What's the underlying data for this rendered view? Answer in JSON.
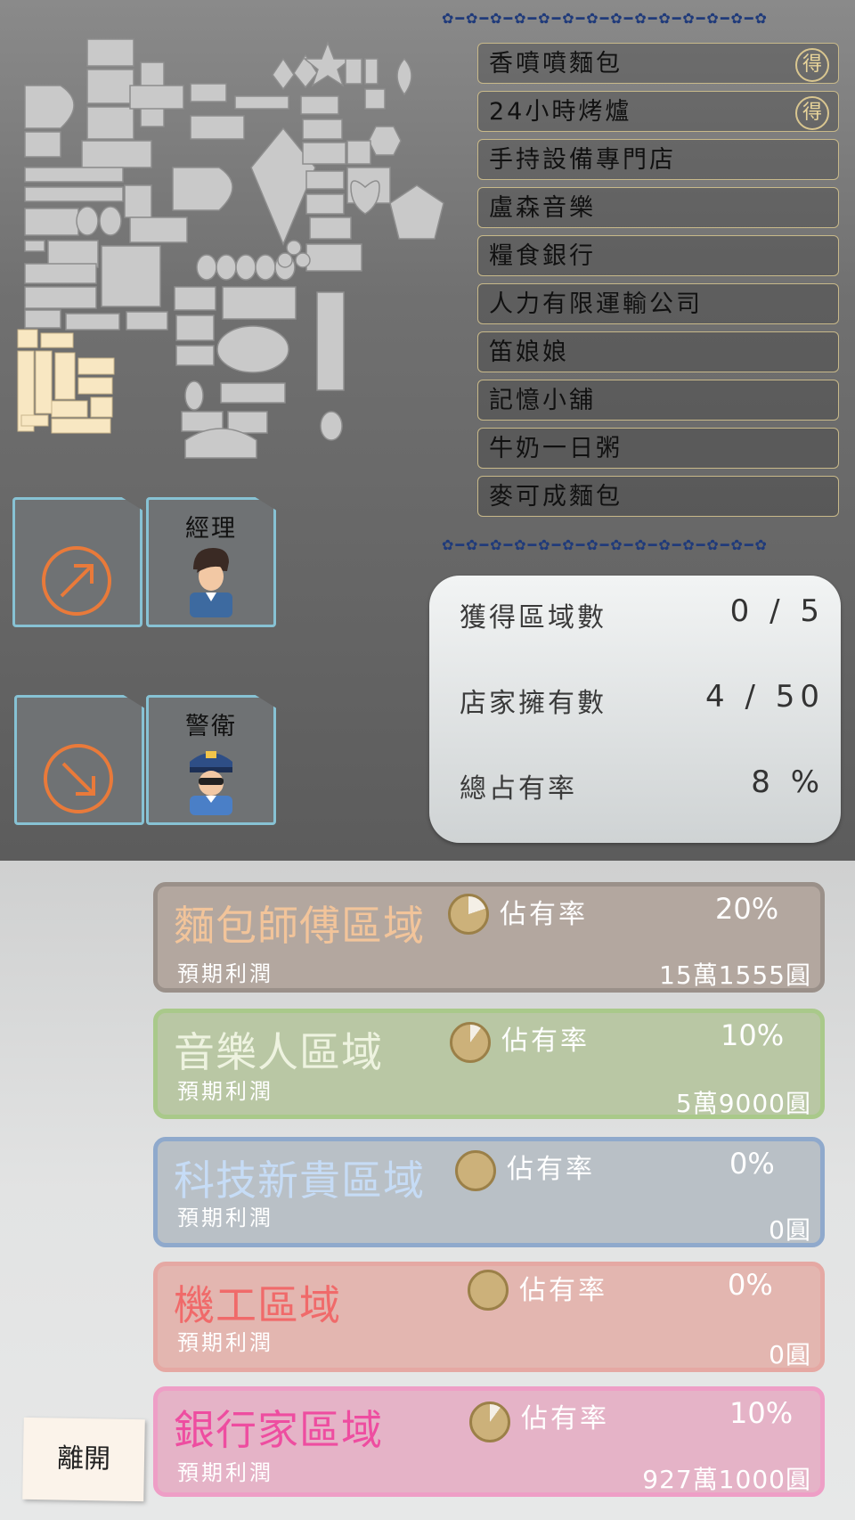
{
  "stores": [
    {
      "name": "香噴噴麵包",
      "badge": "得"
    },
    {
      "name": "24小時烤爐",
      "badge": "得"
    },
    {
      "name": "手持設備專門店",
      "badge": ""
    },
    {
      "name": "盧森音樂",
      "badge": ""
    },
    {
      "name": "糧食銀行",
      "badge": ""
    },
    {
      "name": "人力有限運輸公司",
      "badge": ""
    },
    {
      "name": "笛娘娘",
      "badge": ""
    },
    {
      "name": "記憶小舖",
      "badge": ""
    },
    {
      "name": "牛奶一日粥",
      "badge": ""
    },
    {
      "name": "麥可成麵包",
      "badge": ""
    }
  ],
  "roles": {
    "manager": {
      "label": "經理",
      "icon": "manager-avatar-icon"
    },
    "guard": {
      "label": "警衛",
      "icon": "guard-avatar-icon"
    }
  },
  "stats": [
    {
      "label": "獲得區域數",
      "value": "0 / 5"
    },
    {
      "label": "店家擁有數",
      "value": "4 / 50"
    },
    {
      "label": "總占有率",
      "value": "8 %"
    }
  ],
  "regions": [
    {
      "name": "麵包師傅區域",
      "occupancy_label": "佔有率",
      "occupancy": "20%",
      "occupancy_fraction": 0.2,
      "profit_label": "預期利潤",
      "profit": "15萬1555圓",
      "name_color": "#f2c49a",
      "bg": "#b3a79f",
      "border": "#9a9089"
    },
    {
      "name": "音樂人區域",
      "occupancy_label": "佔有率",
      "occupancy": "10%",
      "occupancy_fraction": 0.1,
      "profit_label": "預期利潤",
      "profit": "5萬9000圓",
      "name_color": "#eef3e0",
      "bg": "#b9c7a4",
      "border": "#a9c98a"
    },
    {
      "name": "科技新貴區域",
      "occupancy_label": "佔有率",
      "occupancy": "0%",
      "occupancy_fraction": 0,
      "profit_label": "預期利潤",
      "profit": "0圓",
      "name_color": "#c6dcf6",
      "bg": "#b9c0c6",
      "border": "#8fa9cc"
    },
    {
      "name": "機工區域",
      "occupancy_label": "佔有率",
      "occupancy": "0%",
      "occupancy_fraction": 0,
      "profit_label": "預期利潤",
      "profit": "0圓",
      "name_color": "#f06a6a",
      "bg": "#e3b6b0",
      "border": "#e5a8a3"
    },
    {
      "name": "銀行家區域",
      "occupancy_label": "佔有率",
      "occupancy": "10%",
      "occupancy_fraction": 0.1,
      "profit_label": "預期利潤",
      "profit": "927萬1000圓",
      "name_color": "#ee4da0",
      "bg": "#e5b3c7",
      "border": "#ee9ec6"
    }
  ],
  "leave_label": "離開"
}
